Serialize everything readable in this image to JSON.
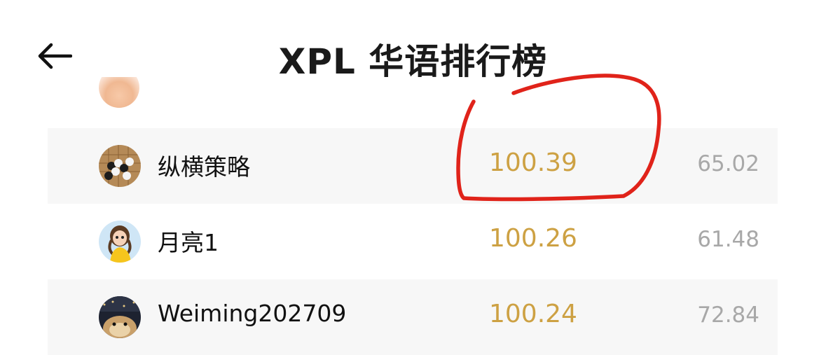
{
  "header": {
    "title": "XPL 华语排行榜",
    "back_icon": "arrow-left-icon"
  },
  "colors": {
    "score": "#cda143",
    "secondary": "#a8a8a8",
    "row_shade": "#f7f7f7",
    "annotation": "#e0231a"
  },
  "rows": [
    {
      "name": "纵横策略",
      "score": "100.39",
      "secondary": "65.02",
      "avatar": "go-board-avatar"
    },
    {
      "name": "月亮1",
      "score": "100.26",
      "secondary": "61.48",
      "avatar": "cartoon-girl-avatar"
    },
    {
      "name": "Weiming202709",
      "score": "100.24",
      "secondary": "72.84",
      "avatar": "hamster-avatar"
    }
  ]
}
